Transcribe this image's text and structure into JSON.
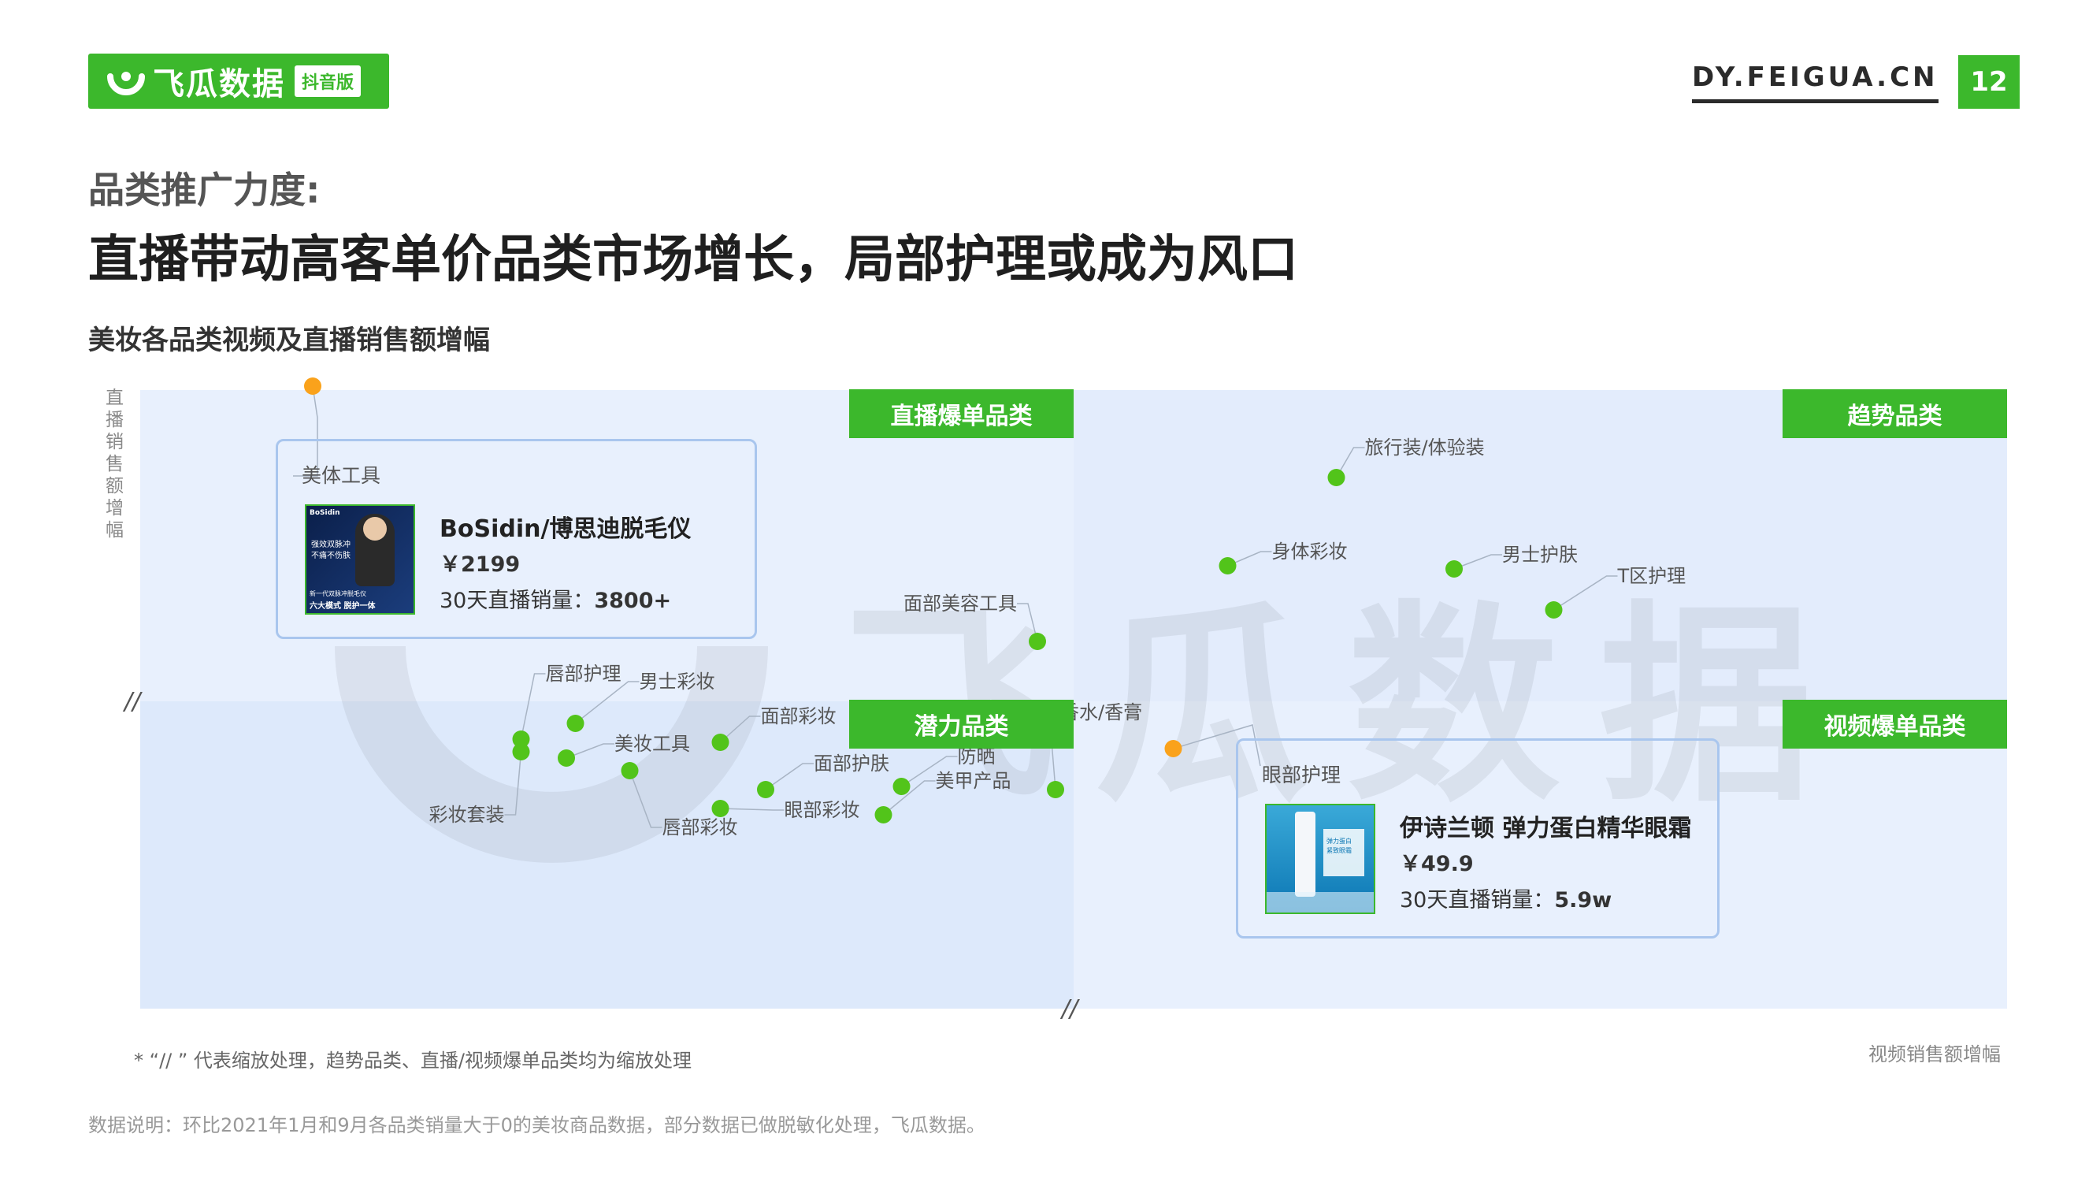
{
  "header": {
    "logo_text": "飞瓜数据",
    "logo_badge": "抖音版",
    "site_url": "DY.FEIGUA.CN",
    "page_number": "12"
  },
  "title": {
    "sub": "品类推广力度:",
    "main": "直播带动高客单价品类市场增长，局部护理或成为风口"
  },
  "chart_title": "美妆各品类视频及直播销售额增幅",
  "colors": {
    "brand_green": "#3cb82c",
    "point_green": "#52c41a",
    "point_orange": "#faa21b",
    "quad_light": "#e8f0fd",
    "quad_mid": "#dde9fb"
  },
  "chart_data": {
    "type": "scatter",
    "xlabel": "视频销售额增幅",
    "ylabel": "直播销售额增幅",
    "axis_break": "//",
    "quadrants": [
      "直播爆单品类",
      "趋势品类",
      "潜力品类",
      "视频爆单品类"
    ],
    "points": [
      {
        "label": "美体工具",
        "x": -8.4,
        "y": 10.0,
        "color": "orange"
      },
      {
        "label": "旅行装/体验装",
        "x": 2.9,
        "y": 7.1,
        "color": "green"
      },
      {
        "label": "身体彩妆",
        "x": 1.7,
        "y": 4.3,
        "color": "green"
      },
      {
        "label": "男士护肤",
        "x": 4.2,
        "y": 4.2,
        "color": "green"
      },
      {
        "label": "T区护理",
        "x": 5.3,
        "y": 2.9,
        "color": "green"
      },
      {
        "label": "面部美容工具",
        "x": -0.4,
        "y": 1.9,
        "color": "green"
      },
      {
        "label": "唇部护理",
        "x": -6.1,
        "y": -1.2,
        "color": "green"
      },
      {
        "label": "男士彩妆",
        "x": -5.5,
        "y": -0.7,
        "color": "green"
      },
      {
        "label": "彩妆套装",
        "x": -6.1,
        "y": -1.6,
        "color": "green"
      },
      {
        "label": "面部彩妆",
        "x": -3.9,
        "y": -1.3,
        "color": "green"
      },
      {
        "label": "美妆工具",
        "x": -5.6,
        "y": -1.8,
        "color": "green"
      },
      {
        "label": "唇部彩妆",
        "x": -4.9,
        "y": -2.2,
        "color": "green"
      },
      {
        "label": "面部护肤",
        "x": -3.4,
        "y": -2.8,
        "color": "green"
      },
      {
        "label": "眼部彩妆",
        "x": -3.9,
        "y": -3.4,
        "color": "green"
      },
      {
        "label": "防晒",
        "x": -1.9,
        "y": -2.7,
        "color": "green"
      },
      {
        "label": "美甲产品",
        "x": -2.1,
        "y": -3.6,
        "color": "green"
      },
      {
        "label": "香水/香膏",
        "x": -0.2,
        "y": -2.8,
        "color": "green"
      },
      {
        "label": "眼部护理",
        "x": 1.1,
        "y": -1.5,
        "color": "orange"
      }
    ]
  },
  "callouts": [
    {
      "category": "美体工具",
      "product": "BoSidin/博思迪脱毛仪",
      "price": "￥2199",
      "sales_label": "30天直播销量：",
      "sales_value": "3800+",
      "image_brand": "BoSidin",
      "image_caption1": "强效双脉冲",
      "image_caption2": "不痛不伤肤",
      "image_caption3": "新一代双脉冲脱毛仪",
      "image_caption4": "六大模式 脱护一体"
    },
    {
      "category": "眼部护理",
      "product": "伊诗兰顿 弹力蛋白精华眼霜",
      "price": "￥49.9",
      "sales_label": "30天直播销量：",
      "sales_value": "5.9w",
      "image_caption1": "弹力蛋白",
      "image_caption2": "紧致眼霜"
    }
  ],
  "watermark": "飞瓜数据",
  "footnote": "* “// ” 代表缩放处理，趋势品类、直播/视频爆单品类均为缩放处理",
  "source": "数据说明：环比2021年1月和9月各品类销量大于0的美妆商品数据，部分数据已做脱敏化处理，飞瓜数据。"
}
